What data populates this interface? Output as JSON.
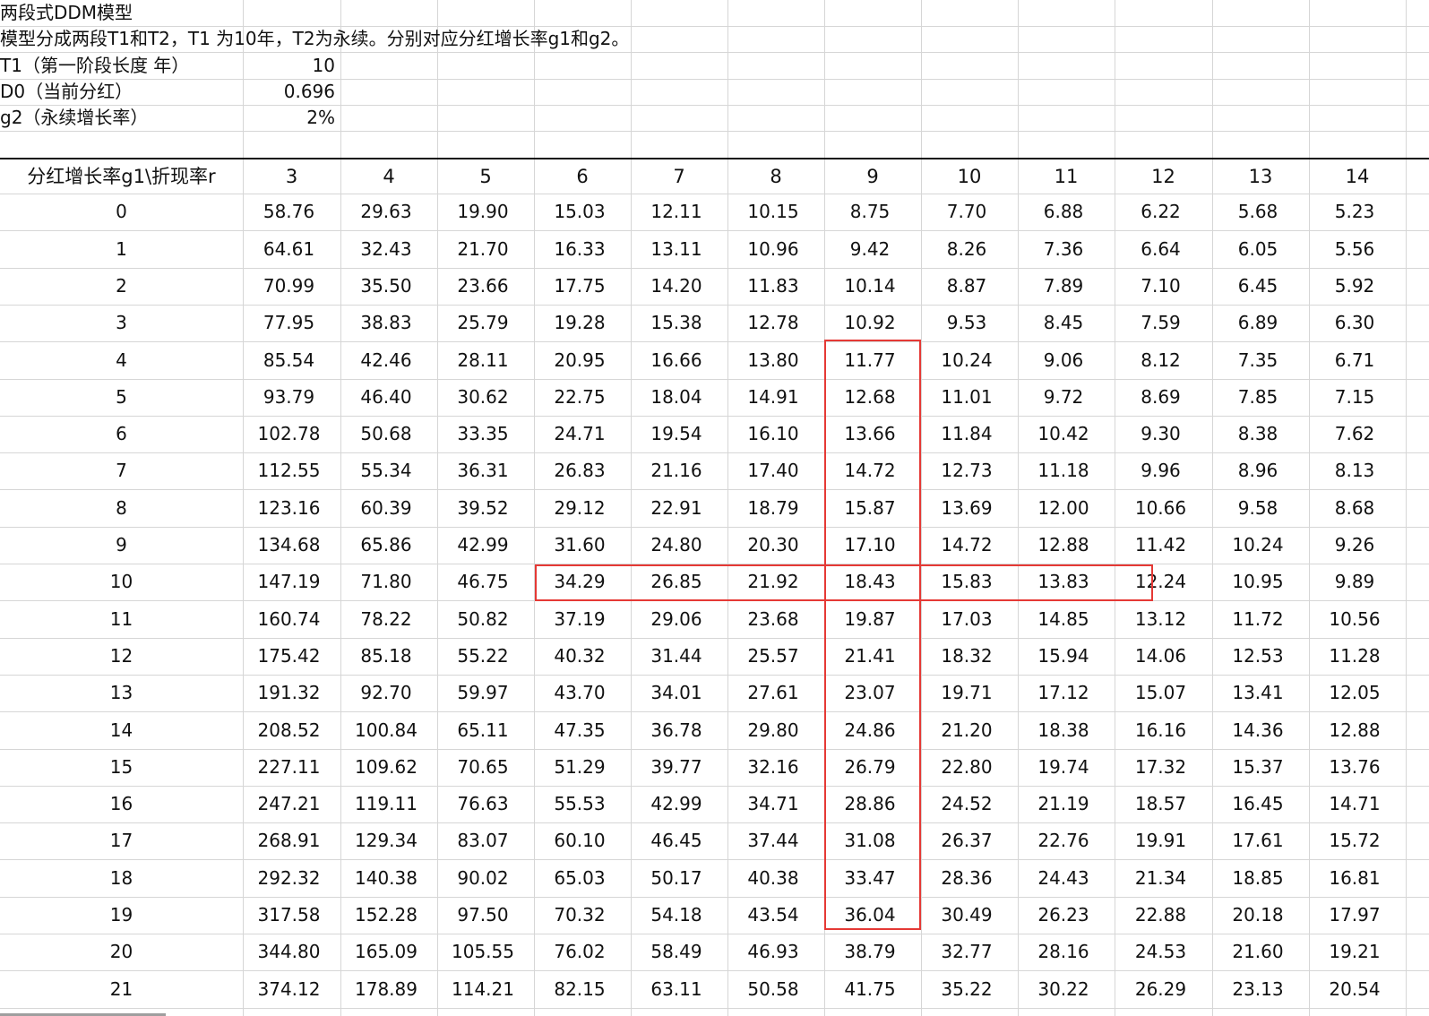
{
  "sheet": {
    "title": "两段式DDM模型",
    "subtitle": "模型分成两段T1和T2，T1 为10年，T2为永续。分别对应分红增长率g1和g2。",
    "params": [
      {
        "label": "T1（第一阶段长度 年）",
        "value": "10"
      },
      {
        "label": "D0（当前分红）",
        "value": "0.696"
      },
      {
        "label": "g2（永续增长率）",
        "value": "2%"
      }
    ],
    "corner_header": "分红增长率g1\\折现率r",
    "col_headers": [
      "3",
      "4",
      "5",
      "6",
      "7",
      "8",
      "9",
      "10",
      "11",
      "12",
      "13",
      "14"
    ],
    "rows": [
      {
        "g1": "0",
        "v": [
          "58.76",
          "29.63",
          "19.90",
          "15.03",
          "12.11",
          "10.15",
          "8.75",
          "7.70",
          "6.88",
          "6.22",
          "5.68",
          "5.23"
        ]
      },
      {
        "g1": "1",
        "v": [
          "64.61",
          "32.43",
          "21.70",
          "16.33",
          "13.11",
          "10.96",
          "9.42",
          "8.26",
          "7.36",
          "6.64",
          "6.05",
          "5.56"
        ]
      },
      {
        "g1": "2",
        "v": [
          "70.99",
          "35.50",
          "23.66",
          "17.75",
          "14.20",
          "11.83",
          "10.14",
          "8.87",
          "7.89",
          "7.10",
          "6.45",
          "5.92"
        ]
      },
      {
        "g1": "3",
        "v": [
          "77.95",
          "38.83",
          "25.79",
          "19.28",
          "15.38",
          "12.78",
          "10.92",
          "9.53",
          "8.45",
          "7.59",
          "6.89",
          "6.30"
        ]
      },
      {
        "g1": "4",
        "v": [
          "85.54",
          "42.46",
          "28.11",
          "20.95",
          "16.66",
          "13.80",
          "11.77",
          "10.24",
          "9.06",
          "8.12",
          "7.35",
          "6.71"
        ]
      },
      {
        "g1": "5",
        "v": [
          "93.79",
          "46.40",
          "30.62",
          "22.75",
          "18.04",
          "14.91",
          "12.68",
          "11.01",
          "9.72",
          "8.69",
          "7.85",
          "7.15"
        ]
      },
      {
        "g1": "6",
        "v": [
          "102.78",
          "50.68",
          "33.35",
          "24.71",
          "19.54",
          "16.10",
          "13.66",
          "11.84",
          "10.42",
          "9.30",
          "8.38",
          "7.62"
        ]
      },
      {
        "g1": "7",
        "v": [
          "112.55",
          "55.34",
          "36.31",
          "26.83",
          "21.16",
          "17.40",
          "14.72",
          "12.73",
          "11.18",
          "9.96",
          "8.96",
          "8.13"
        ]
      },
      {
        "g1": "8",
        "v": [
          "123.16",
          "60.39",
          "39.52",
          "29.12",
          "22.91",
          "18.79",
          "15.87",
          "13.69",
          "12.00",
          "10.66",
          "9.58",
          "8.68"
        ]
      },
      {
        "g1": "9",
        "v": [
          "134.68",
          "65.86",
          "42.99",
          "31.60",
          "24.80",
          "20.30",
          "17.10",
          "14.72",
          "12.88",
          "11.42",
          "10.24",
          "9.26"
        ]
      },
      {
        "g1": "10",
        "v": [
          "147.19",
          "71.80",
          "46.75",
          "34.29",
          "26.85",
          "21.92",
          "18.43",
          "15.83",
          "13.83",
          "12.24",
          "10.95",
          "9.89"
        ]
      },
      {
        "g1": "11",
        "v": [
          "160.74",
          "78.22",
          "50.82",
          "37.19",
          "29.06",
          "23.68",
          "19.87",
          "17.03",
          "14.85",
          "13.12",
          "11.72",
          "10.56"
        ]
      },
      {
        "g1": "12",
        "v": [
          "175.42",
          "85.18",
          "55.22",
          "40.32",
          "31.44",
          "25.57",
          "21.41",
          "18.32",
          "15.94",
          "14.06",
          "12.53",
          "11.28"
        ]
      },
      {
        "g1": "13",
        "v": [
          "191.32",
          "92.70",
          "59.97",
          "43.70",
          "34.01",
          "27.61",
          "23.07",
          "19.71",
          "17.12",
          "15.07",
          "13.41",
          "12.05"
        ]
      },
      {
        "g1": "14",
        "v": [
          "208.52",
          "100.84",
          "65.11",
          "47.35",
          "36.78",
          "29.80",
          "24.86",
          "21.20",
          "18.38",
          "16.16",
          "14.36",
          "12.88"
        ]
      },
      {
        "g1": "15",
        "v": [
          "227.11",
          "109.62",
          "70.65",
          "51.29",
          "39.77",
          "32.16",
          "26.79",
          "22.80",
          "19.74",
          "17.32",
          "15.37",
          "13.76"
        ]
      },
      {
        "g1": "16",
        "v": [
          "247.21",
          "119.11",
          "76.63",
          "55.53",
          "42.99",
          "34.71",
          "28.86",
          "24.52",
          "21.19",
          "18.57",
          "16.45",
          "14.71"
        ]
      },
      {
        "g1": "17",
        "v": [
          "268.91",
          "129.34",
          "83.07",
          "60.10",
          "46.45",
          "37.44",
          "31.08",
          "26.37",
          "22.76",
          "19.91",
          "17.61",
          "15.72"
        ]
      },
      {
        "g1": "18",
        "v": [
          "292.32",
          "140.38",
          "90.02",
          "65.03",
          "50.17",
          "40.38",
          "33.47",
          "28.36",
          "24.43",
          "21.34",
          "18.85",
          "16.81"
        ]
      },
      {
        "g1": "19",
        "v": [
          "317.58",
          "152.28",
          "97.50",
          "70.32",
          "54.18",
          "43.54",
          "36.04",
          "30.49",
          "26.23",
          "22.88",
          "20.18",
          "17.97"
        ]
      },
      {
        "g1": "20",
        "v": [
          "344.80",
          "165.09",
          "105.55",
          "76.02",
          "58.49",
          "46.93",
          "38.79",
          "32.77",
          "28.16",
          "24.53",
          "21.60",
          "19.21"
        ]
      },
      {
        "g1": "21",
        "v": [
          "374.12",
          "178.89",
          "114.21",
          "82.15",
          "63.11",
          "50.58",
          "41.75",
          "35.22",
          "30.22",
          "26.29",
          "23.13",
          "20.54"
        ]
      }
    ],
    "highlight": {
      "color": "#e53935",
      "column_header": "9",
      "column_from_g1": "4",
      "column_to_g1": "19",
      "row_g1": "10",
      "row_from_header": "6",
      "row_to_header": "12"
    }
  }
}
